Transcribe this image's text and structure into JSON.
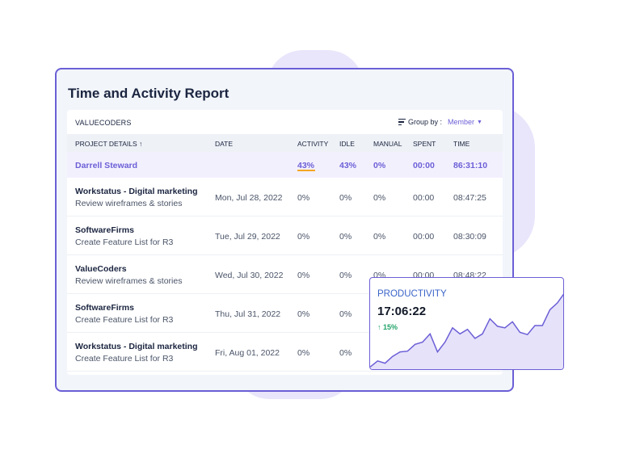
{
  "report": {
    "title": "Time and Activity Report",
    "organization": "VALUECODERS",
    "group_by_label": "Group by :",
    "group_by_value": "Member"
  },
  "table": {
    "headers": {
      "project": "PROJECT DETAILS ↑",
      "date": "DATE",
      "activity": "ACTIVITY",
      "idle": "IDLE",
      "manual": "MANUAL",
      "spent": "SPENT",
      "time": "TIME"
    },
    "summary": {
      "name": "Darrell Steward",
      "activity": "43%",
      "idle": "43%",
      "manual": "0%",
      "spent": "00:00",
      "time": "86:31:10"
    },
    "rows": [
      {
        "project": "Workstatus - Digital marketing",
        "task": "Review wireframes & stories",
        "date": "Mon, Jul 28, 2022",
        "activity": "0%",
        "idle": "0%",
        "manual": "0%",
        "spent": "00:00",
        "time": "08:47:25"
      },
      {
        "project": "SoftwareFirms",
        "task": "Create Feature List for R3",
        "date": "Tue, Jul 29, 2022",
        "activity": "0%",
        "idle": "0%",
        "manual": "0%",
        "spent": "00:00",
        "time": "08:30:09"
      },
      {
        "project": "ValueCoders",
        "task": "Review wireframes & stories",
        "date": "Wed, Jul 30, 2022",
        "activity": "0%",
        "idle": "0%",
        "manual": "0%",
        "spent": "00:00",
        "time": "08:48:22"
      },
      {
        "project": "SoftwareFirms",
        "task": "Create Feature List for R3",
        "date": "Thu, Jul 31, 2022",
        "activity": "0%",
        "idle": "0%",
        "manual": "",
        "spent": "",
        "time": ""
      },
      {
        "project": "Workstatus - Digital marketing",
        "task": "Create Feature List for R3",
        "date": "Fri, Aug 01, 2022",
        "activity": "0%",
        "idle": "0%",
        "manual": "",
        "spent": "",
        "time": ""
      }
    ]
  },
  "productivity": {
    "label": "PRODUCTIVITY",
    "time": "17:06:22",
    "delta": "↑ 15%",
    "colors": {
      "line": "#6b5fd6",
      "fill": "#e6e2fa",
      "delta": "#22a36a"
    },
    "trend": [
      4,
      12,
      9,
      18,
      24,
      25,
      34,
      37,
      48,
      24,
      37,
      56,
      48,
      54,
      42,
      48,
      68,
      58,
      56,
      64,
      50,
      47,
      59,
      59,
      80,
      89,
      103
    ]
  },
  "colors": {
    "accent": "#6b5fd6",
    "summary_bg": "#f3f0fe",
    "activity_underline": "#f5a623"
  }
}
